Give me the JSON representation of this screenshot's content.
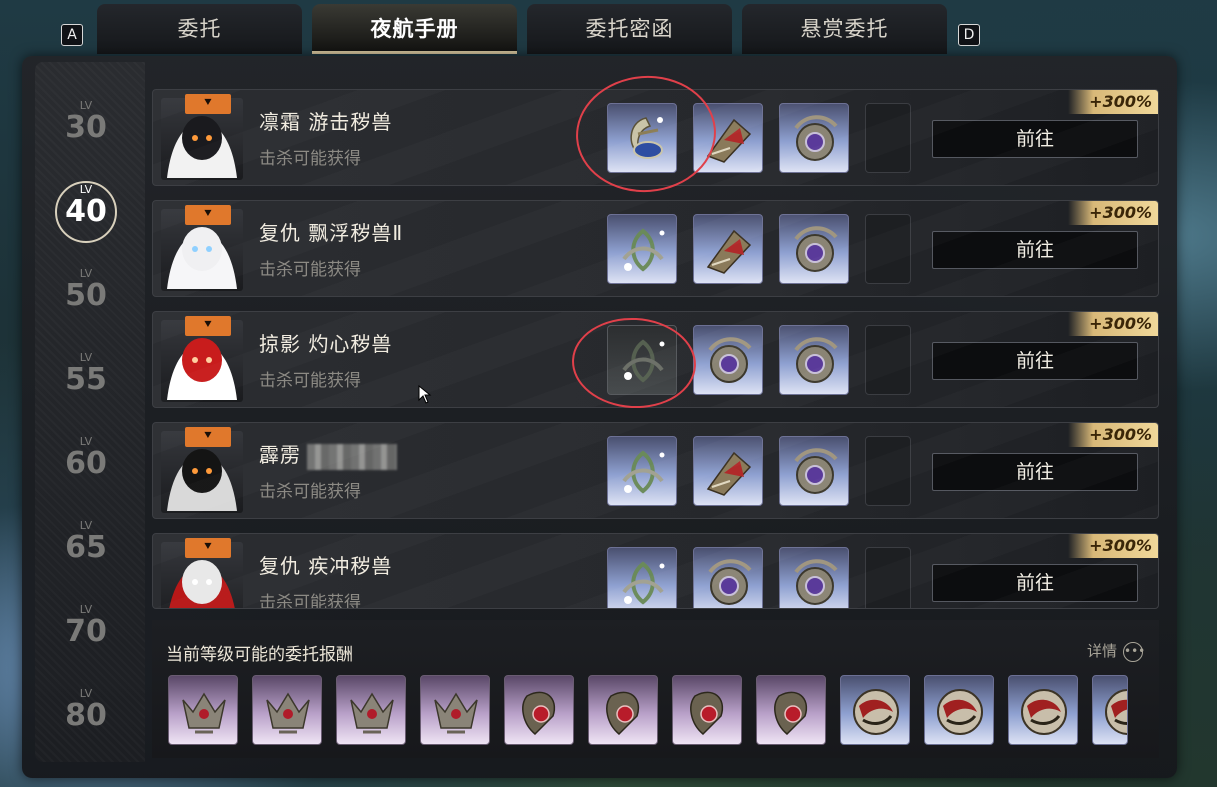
{
  "key_left": "A",
  "key_right": "D",
  "tabs": [
    {
      "label": "委托",
      "active": false
    },
    {
      "label": "夜航手册",
      "active": true
    },
    {
      "label": "委托密函",
      "active": false
    },
    {
      "label": "悬赏委托",
      "active": false
    }
  ],
  "levels": [
    {
      "prefix": "LV",
      "value": "30",
      "active": false
    },
    {
      "prefix": "LV",
      "value": "40",
      "active": true
    },
    {
      "prefix": "LV",
      "value": "50",
      "active": false
    },
    {
      "prefix": "LV",
      "value": "55",
      "active": false
    },
    {
      "prefix": "LV",
      "value": "60",
      "active": false
    },
    {
      "prefix": "LV",
      "value": "65",
      "active": false
    },
    {
      "prefix": "LV",
      "value": "70",
      "active": false
    },
    {
      "prefix": "LV",
      "value": "80",
      "active": false
    }
  ],
  "entries": [
    {
      "name": "凛霜 游击秽兽",
      "subtitle": "击杀可能获得",
      "bonus": "+300%",
      "button": "前往",
      "rewards": [
        "crescent-blue",
        "weapon-red",
        "ring-purple"
      ]
    },
    {
      "name": "复仇 飘浮秽兽Ⅱ",
      "subtitle": "击杀可能获得",
      "bonus": "+300%",
      "button": "前往",
      "rewards": [
        "triquetra-green",
        "weapon-red",
        "ring-purple"
      ]
    },
    {
      "name": "掠影 灼心秽兽",
      "subtitle": "击杀可能获得",
      "bonus": "+300%",
      "button": "前往",
      "rewards": [
        "triquetra-dark",
        "ring-purple",
        "ring-purple"
      ]
    },
    {
      "name": "霹雳",
      "subtitle": "击杀可能获得",
      "bonus": "+300%",
      "button": "前往",
      "rewards": [
        "triquetra-green",
        "weapon-red",
        "ring-purple"
      ]
    },
    {
      "name": "复仇 疾冲秽兽",
      "subtitle": "击杀可能获得",
      "bonus": "+300%",
      "button": "前往",
      "rewards": [
        "triquetra-green",
        "ring-purple",
        "ring-purple"
      ]
    }
  ],
  "bottom": {
    "title": "当前等级可能的委托报酬",
    "details": "详情",
    "items": [
      "crown-purple",
      "crown-purple",
      "crown-purple",
      "crown-purple",
      "gem-red",
      "gem-red",
      "gem-red",
      "gem-red",
      "disc-blue",
      "disc-blue",
      "disc-blue",
      "disc-blue"
    ]
  },
  "colors": {
    "accent_orange": "#e0782c",
    "bonus_gold": "#f0d89a",
    "annotation_red": "#e0404a"
  }
}
